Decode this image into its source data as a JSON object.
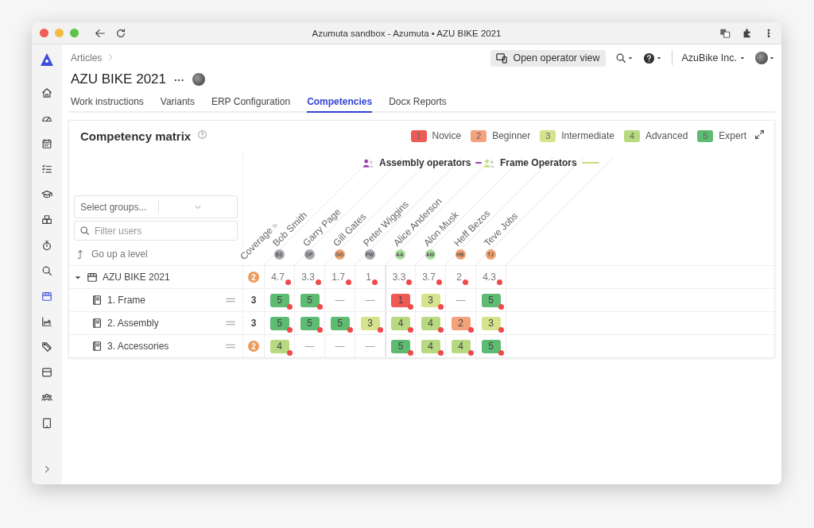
{
  "browser": {
    "title": "Azumuta sandbox - Azumuta • AZU BIKE 2021"
  },
  "sidebar": {
    "items": [
      {
        "kind": "home",
        "selected": false
      },
      {
        "kind": "gauge",
        "selected": false
      },
      {
        "kind": "calendar",
        "selected": false
      },
      {
        "kind": "checklist",
        "selected": false
      },
      {
        "kind": "graduation",
        "selected": false
      },
      {
        "kind": "boxes",
        "selected": false
      },
      {
        "kind": "timer",
        "selected": false
      },
      {
        "kind": "search",
        "selected": false
      },
      {
        "kind": "box",
        "selected": true
      },
      {
        "kind": "chart",
        "selected": false
      },
      {
        "kind": "tags",
        "selected": false
      },
      {
        "kind": "package",
        "selected": false
      },
      {
        "kind": "people",
        "selected": false
      },
      {
        "kind": "tablet",
        "selected": false
      }
    ]
  },
  "breadcrumb": {
    "items": [
      "Articles"
    ]
  },
  "header": {
    "operator_view": "Open operator view",
    "company": "AzuBike Inc."
  },
  "article": {
    "title": "AZU BIKE 2021",
    "more": "···"
  },
  "tabs": [
    {
      "label": "Work instructions",
      "selected": false
    },
    {
      "label": "Variants",
      "selected": false
    },
    {
      "label": "ERP Configuration",
      "selected": false
    },
    {
      "label": "Competencies",
      "selected": true
    },
    {
      "label": "Docx Reports",
      "selected": false
    }
  ],
  "matrix": {
    "title": "Competency matrix",
    "legend": [
      {
        "number": "1",
        "label": "Novice",
        "color": "#ef5a55"
      },
      {
        "number": "2",
        "label": "Beginner",
        "color": "#f4a27c"
      },
      {
        "number": "3",
        "label": "Intermediate",
        "color": "#d6e28c"
      },
      {
        "number": "4",
        "label": "Advanced",
        "color": "#b7da80"
      },
      {
        "number": "5",
        "label": "Expert",
        "color": "#5dbb72"
      }
    ],
    "groups_placeholder": "Select groups...",
    "filter_placeholder": "Filter users",
    "go_up": "Go up a level",
    "coverage_label": "Coverage",
    "coverage_marker": "»",
    "groups": [
      {
        "name": "Assembly operators",
        "color": "#9c3fb6",
        "users": [
          {
            "name": "Bob Smith",
            "initials": "BS",
            "color": "#a8aab2"
          },
          {
            "name": "Garry Page",
            "initials": "GP",
            "color": "#a8aab2"
          },
          {
            "name": "Gill Gates",
            "initials": "GG",
            "color": "#f0a172"
          },
          {
            "name": "Peter Wiggins",
            "initials": "PW",
            "color": "#a8aab2"
          }
        ]
      },
      {
        "name": "Frame Operators",
        "color": "#c8dc7c",
        "users": [
          {
            "name": "Alice Anderson",
            "initials": "AA",
            "color": "#a9dc9f"
          },
          {
            "name": "Alon Musk",
            "initials": "AM",
            "color": "#a9dc9f"
          },
          {
            "name": "Heff Bezos",
            "initials": "HB",
            "color": "#f0a172"
          },
          {
            "name": "Teve Jobs",
            "initials": "TJ",
            "color": "#f0a172"
          }
        ]
      }
    ],
    "rows": [
      {
        "label": "AZU BIKE 2021",
        "expanded": true,
        "coverage": {
          "text": "2",
          "warning": true
        },
        "cells": [
          {
            "kind": "average",
            "text": "4.7",
            "alert": true
          },
          {
            "kind": "average",
            "text": "3.3",
            "alert": true
          },
          {
            "kind": "average",
            "text": "1.7",
            "alert": true
          },
          {
            "kind": "average",
            "text": "1",
            "alert": true
          },
          {
            "kind": "average",
            "text": "3.3",
            "alert": true
          },
          {
            "kind": "average",
            "text": "3.7",
            "alert": true
          },
          {
            "kind": "average",
            "text": "2",
            "alert": true
          },
          {
            "kind": "average",
            "text": "4.3",
            "alert": true
          }
        ],
        "children": [
          {
            "label": "1. Frame",
            "coverage": {
              "text": "3",
              "warning": false
            },
            "cells": [
              {
                "kind": "score",
                "text": "5",
                "color": "#5dbb72",
                "alert": true
              },
              {
                "kind": "score",
                "text": "5",
                "color": "#5dbb72",
                "alert": true
              },
              {
                "kind": "none",
                "text": "—"
              },
              {
                "kind": "none",
                "text": "—"
              },
              {
                "kind": "score",
                "text": "1",
                "color": "#ef5a55",
                "alert": true
              },
              {
                "kind": "score",
                "text": "3",
                "color": "#d6e28c",
                "alert": true
              },
              {
                "kind": "none",
                "text": "—"
              },
              {
                "kind": "score",
                "text": "5",
                "color": "#5dbb72",
                "alert": true
              }
            ]
          },
          {
            "label": "2. Assembly",
            "coverage": {
              "text": "3",
              "warning": false
            },
            "cells": [
              {
                "kind": "score",
                "text": "5",
                "color": "#5dbb72",
                "alert": true
              },
              {
                "kind": "score",
                "text": "5",
                "color": "#5dbb72",
                "alert": true
              },
              {
                "kind": "score",
                "text": "5",
                "color": "#5dbb72",
                "alert": true
              },
              {
                "kind": "score",
                "text": "3",
                "color": "#d6e28c",
                "alert": true
              },
              {
                "kind": "score",
                "text": "4",
                "color": "#b7da80",
                "alert": true
              },
              {
                "kind": "score",
                "text": "4",
                "color": "#b7da80",
                "alert": true
              },
              {
                "kind": "score",
                "text": "2",
                "color": "#f4a27c",
                "alert": true
              },
              {
                "kind": "score",
                "text": "3",
                "color": "#d6e28c",
                "alert": true
              }
            ]
          },
          {
            "label": "3. Accessories",
            "coverage": {
              "text": "2",
              "warning": true
            },
            "cells": [
              {
                "kind": "score",
                "text": "4",
                "color": "#b7da80",
                "alert": true
              },
              {
                "kind": "none",
                "text": "—"
              },
              {
                "kind": "none",
                "text": "—"
              },
              {
                "kind": "none",
                "text": "—"
              },
              {
                "kind": "score",
                "text": "5",
                "color": "#5dbb72",
                "alert": true
              },
              {
                "kind": "score",
                "text": "4",
                "color": "#b7da80",
                "alert": true
              },
              {
                "kind": "score",
                "text": "4",
                "color": "#b7da80",
                "alert": true
              },
              {
                "kind": "score",
                "text": "5",
                "color": "#5dbb72",
                "alert": true
              }
            ]
          }
        ]
      }
    ]
  }
}
